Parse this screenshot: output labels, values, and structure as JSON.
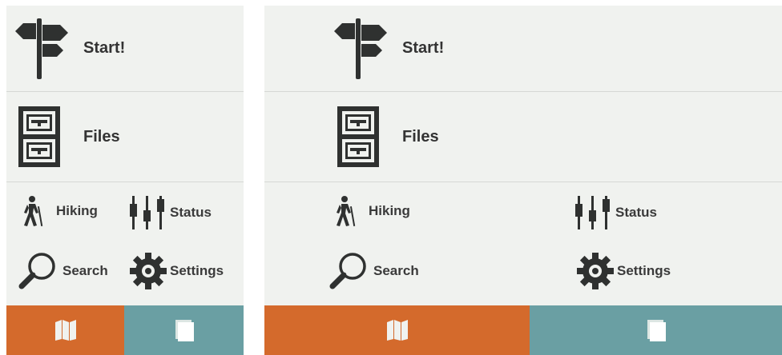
{
  "menu": {
    "start_label": "Start!",
    "files_label": "Files",
    "hiking_label": "Hiking",
    "status_label": "Status",
    "search_label": "Search",
    "settings_label": "Settings"
  },
  "icons": {
    "start": "signpost-icon",
    "files": "file-cabinet-icon",
    "hiking": "hiker-icon",
    "status": "sliders-icon",
    "search": "magnifier-icon",
    "settings": "gear-icon",
    "map_tab": "map-icon",
    "pages_tab": "pages-icon"
  },
  "colors": {
    "map_tab": "#d46a2c",
    "pages_tab": "#6a9fa3",
    "background": "#f0f2ef",
    "icon": "#2f3130"
  }
}
